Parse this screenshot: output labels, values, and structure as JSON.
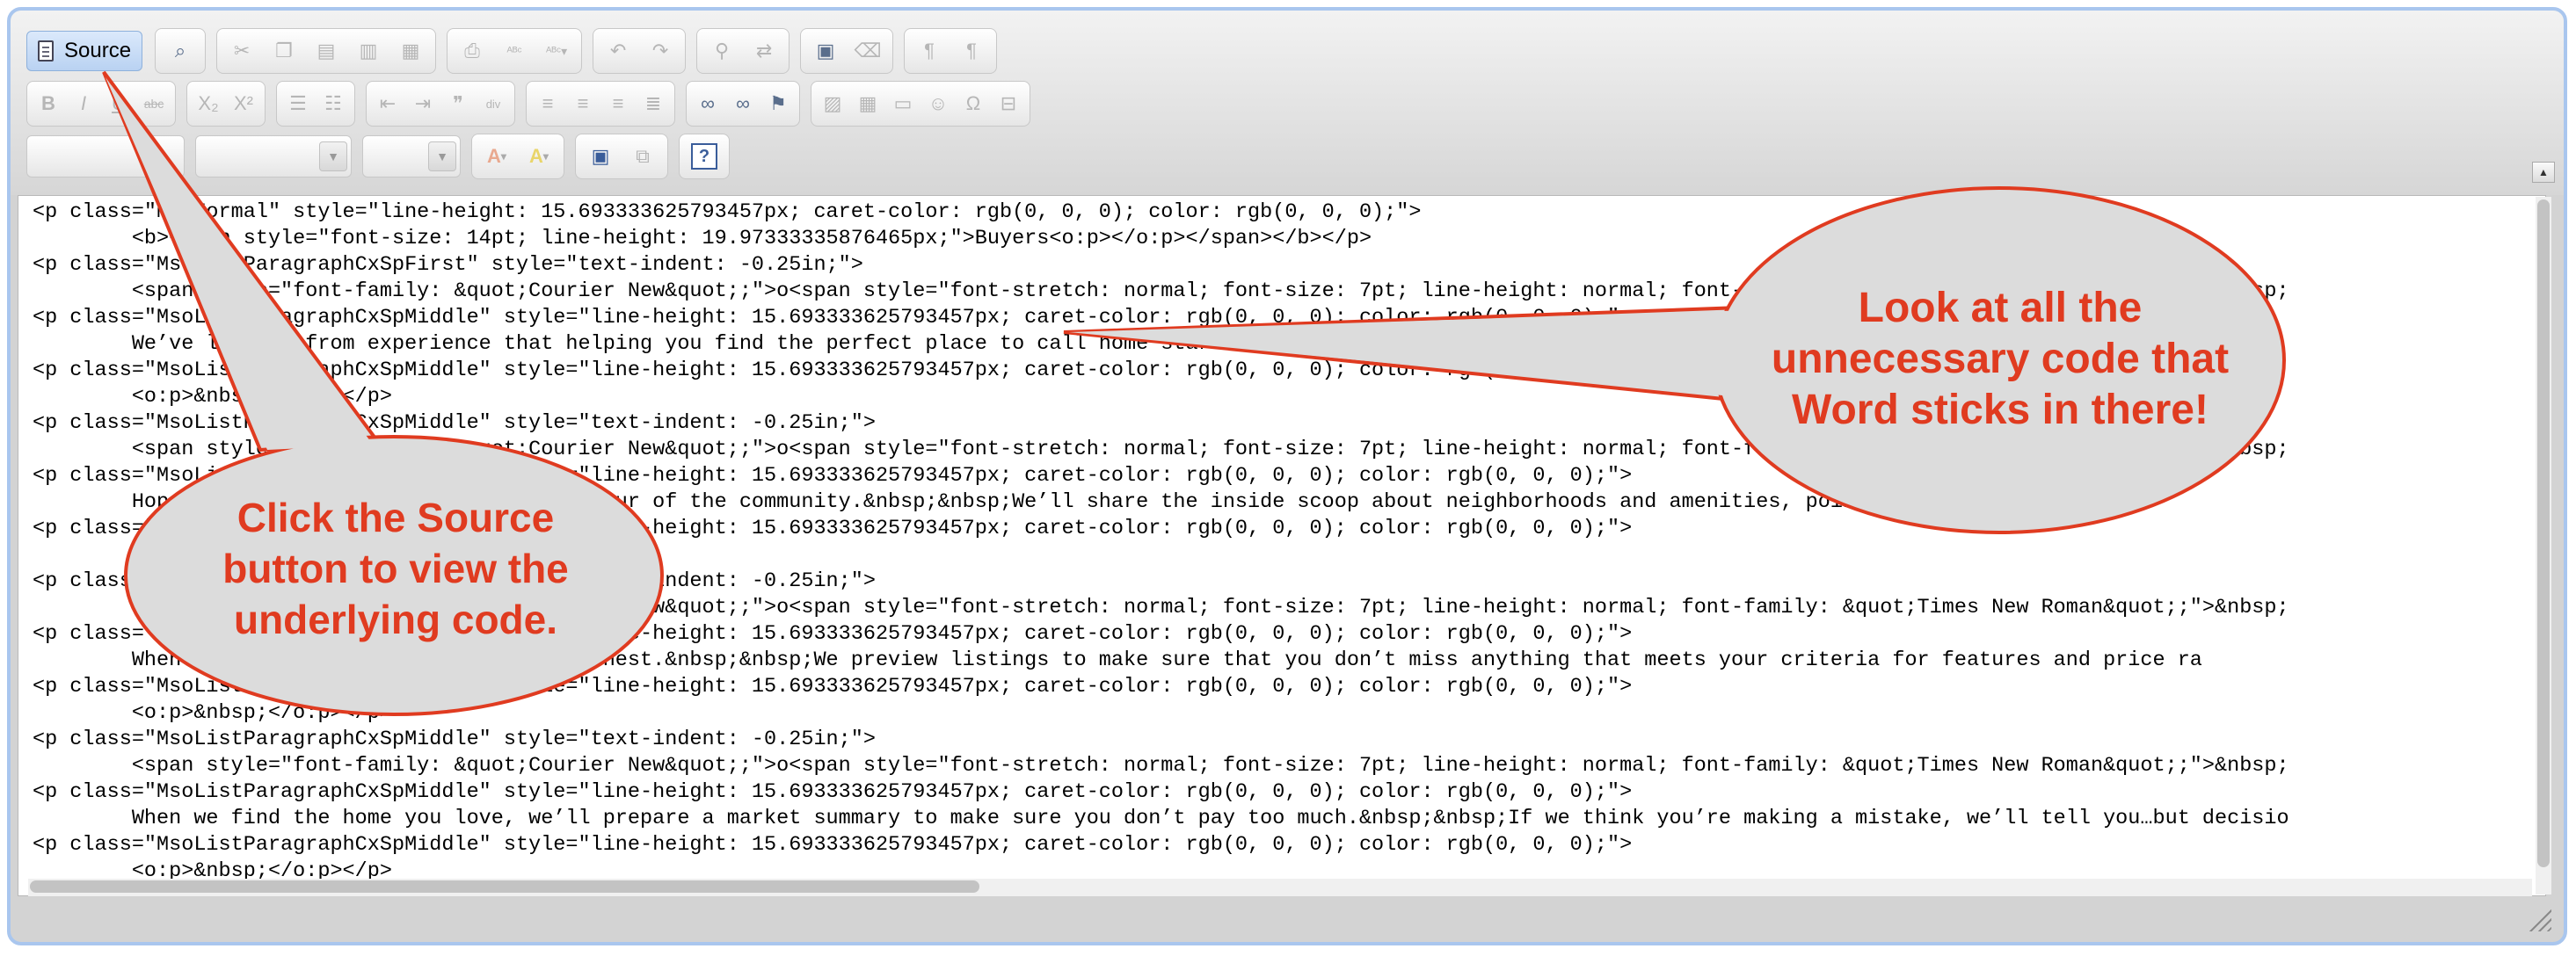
{
  "toolbar": {
    "source_label": "Source",
    "row1_icons": [
      "preview-icon",
      "cut-icon",
      "copy-icon",
      "paste-icon",
      "paste-text-icon",
      "paste-word-icon",
      "print-icon",
      "spellcheck-icon",
      "spellcheck-menu-icon",
      "undo-icon",
      "redo-icon",
      "find-icon",
      "replace-icon",
      "select-all-icon",
      "remove-format-icon",
      "ltr-icon",
      "rtl-icon"
    ],
    "row2_icons": [
      "bold-icon",
      "italic-icon",
      "underline-icon",
      "strike-icon",
      "subscript-icon",
      "superscript-icon",
      "numbered-list-icon",
      "bulleted-list-icon",
      "outdent-icon",
      "indent-icon",
      "blockquote-icon",
      "div-icon",
      "align-left-icon",
      "align-center-icon",
      "align-right-icon",
      "justify-icon",
      "link-icon",
      "unlink-icon",
      "anchor-icon",
      "image-icon",
      "table-icon",
      "horizontal-rule-icon",
      "smiley-icon",
      "special-char-icon",
      "page-break-icon"
    ],
    "row3_icons": [
      "text-color-icon",
      "bg-color-icon",
      "maximize-icon",
      "show-blocks-icon",
      "help-icon"
    ],
    "text_color_letter": "A",
    "bg_color_letter": "A",
    "help_glyph": "?"
  },
  "source_lines": [
    "<p class=\"MsoNormal\" style=\"line-height: 15.693333625793457px; caret-color: rgb(0, 0, 0); color: rgb(0, 0, 0);\">",
    "        <b><span style=\"font-size: 14pt; line-height: 19.97333335876465px;\">Buyers<o:p></o:p></span></b></p>",
    "<p class=\"MsoListParagraphCxSpFirst\" style=\"text-indent: -0.25in;\">",
    "        <span style=\"font-family: &quot;Courier New&quot;;\">o<span style=\"font-stretch: normal; font-size: 7pt; line-height: normal; font-family: &quot;Times New Roman&quot;;\">&nbsp;",
    "<p class=\"MsoListParagraphCxSpMiddle\" style=\"line-height: 15.693333625793457px; caret-color: rgb(0, 0, 0); color: rgb(0, 0, 0);\">",
    "        We’ve learned from experience that helping you find the perfect place to call home starts with listening.&nbsp;&nbsp;Do you need 3 bedrooms (but",
    "<p class=\"MsoListParagraphCxSpMiddle\" style=\"line-height: 15.693333625793457px; caret-color: rgb(0, 0, 0); color: rgb(0, 0, 0);\">",
    "        <o:p>&nbsp;</o:p></p>",
    "<p class=\"MsoListParagraphCxSpMiddle\" style=\"text-indent: -0.25in;\">",
    "        <span style=\"font-family: &quot;Courier New&quot;;\">o<span style=\"font-stretch: normal; font-size: 7pt; line-height: normal; font-family: &quot;Times New Roman&quot;;\">&nbsp;",
    "<p class=\"MsoListParagraphCxSpMiddle\" style=\"line-height: 15.693333625793457px; caret-color: rgb(0, 0, 0); color: rgb(0, 0, 0);\">",
    "        Hop in the car with your agent for a tour of the community.&nbsp;&nbsp;We’ll share the inside scoop about neighborhoods and amenities, pointing out the pro",
    "<p class=\"MsoListParagraphCxSpMiddle\" style=\"line-height: 15.693333625793457px; caret-color: rgb(0, 0, 0); color: rgb(0, 0, 0);\">",
    "",
    "<p class=\"MsoListParagraphCxSpMiddle\" style=\"text-indent: -0.25in;\">",
    "        <span style=\"font-family: &quot;Courier New&quot;;\">o<span style=\"font-stretch: normal; font-size: 7pt; line-height: normal; font-family: &quot;Times New Roman&quot;;\">&nbsp;",
    "<p class=\"MsoListParagraphCxSpMiddle\" style=\"line-height: 15.693333625793457px; caret-color: rgb(0, 0, 0); color: rgb(0, 0, 0);\">",
    "        When you’re ready, we’ll search in earnest.&nbsp;&nbsp;We preview listings to make sure that you don’t miss anything that meets your criteria for features and price ra",
    "<p class=\"MsoListParagraphCxSpMiddle\" style=\"line-height: 15.693333625793457px; caret-color: rgb(0, 0, 0); color: rgb(0, 0, 0);\">",
    "        <o:p>&nbsp;</o:p></p>",
    "<p class=\"MsoListParagraphCxSpMiddle\" style=\"text-indent: -0.25in;\">",
    "        <span style=\"font-family: &quot;Courier New&quot;;\">o<span style=\"font-stretch: normal; font-size: 7pt; line-height: normal; font-family: &quot;Times New Roman&quot;;\">&nbsp;",
    "<p class=\"MsoListParagraphCxSpMiddle\" style=\"line-height: 15.693333625793457px; caret-color: rgb(0, 0, 0); color: rgb(0, 0, 0);\">",
    "        When we find the home you love, we’ll prepare a market summary to make sure you don’t pay too much.&nbsp;&nbsp;If we think you’re making a mistake, we’ll tell you…but decisio",
    "<p class=\"MsoListParagraphCxSpMiddle\" style=\"line-height: 15.693333625793457px; caret-color: rgb(0, 0, 0); color: rgb(0, 0, 0);\">",
    "        <o:p>&nbsp;</o:p></p>"
  ],
  "callouts": {
    "source_hint": {
      "lines": [
        "Click the Source",
        "button to view the",
        "underlying code."
      ]
    },
    "code_hint": {
      "lines": [
        "Look at all the",
        "unnecessary code that",
        "Word sticks in there!"
      ]
    }
  },
  "colors": {
    "callout_text": "#e03b20",
    "callout_fill": "#dcdcdc",
    "callout_stroke": "#e03b20",
    "frame_border": "#a9c6ee"
  }
}
